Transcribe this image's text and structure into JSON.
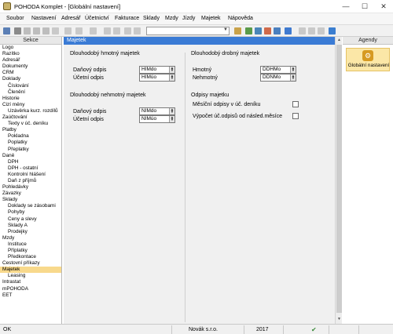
{
  "window": {
    "title": "POHODA Komplet - [Globální nastavení]",
    "minimize": "—",
    "maximize": "☐",
    "close": "✕"
  },
  "menu": [
    "Soubor",
    "Nastavení",
    "Adresář",
    "Účetnictví",
    "Fakturace",
    "Sklady",
    "Mzdy",
    "Jízdy",
    "Majetek",
    "Nápověda"
  ],
  "toolbar": {
    "combo_value": ""
  },
  "sidebar": {
    "header": "Sekce",
    "items": [
      {
        "label": "Logo"
      },
      {
        "label": "Razítko"
      },
      {
        "label": "Adresář"
      },
      {
        "label": "Dokumenty"
      },
      {
        "label": "CRM"
      },
      {
        "label": "Doklady"
      },
      {
        "label": "Číslování",
        "sub": true
      },
      {
        "label": "Členění",
        "sub": true
      },
      {
        "label": "Historie"
      },
      {
        "label": "Cizí měny"
      },
      {
        "label": "Uzávěrka kurz. rozdílů",
        "sub": true
      },
      {
        "label": "Zaúčtování"
      },
      {
        "label": "Texty v úč. deníku",
        "sub": true
      },
      {
        "label": "Platby"
      },
      {
        "label": "Pokladna",
        "sub": true
      },
      {
        "label": "Poplatky",
        "sub": true
      },
      {
        "label": "Přeplatky",
        "sub": true
      },
      {
        "label": "Daně"
      },
      {
        "label": "DPH",
        "sub": true
      },
      {
        "label": "DPH - ostatní",
        "sub": true
      },
      {
        "label": "Kontrolní hlášení",
        "sub": true
      },
      {
        "label": "Daň z příjmů",
        "sub": true
      },
      {
        "label": "Pohledávky"
      },
      {
        "label": "Závazky"
      },
      {
        "label": "Sklady"
      },
      {
        "label": "Doklady se zásobami",
        "sub": true
      },
      {
        "label": "Pohyby",
        "sub": true
      },
      {
        "label": "Ceny a slevy",
        "sub": true
      },
      {
        "label": "Sklady A",
        "sub": true
      },
      {
        "label": "Prodejky",
        "sub": true
      },
      {
        "label": "Mzdy"
      },
      {
        "label": "Instituce",
        "sub": true
      },
      {
        "label": "Příplatky",
        "sub": true
      },
      {
        "label": "Předkontace",
        "sub": true
      },
      {
        "label": "Cestovní příkazy"
      },
      {
        "label": "Majetek",
        "selected": true
      },
      {
        "label": "Leasing",
        "sub": true
      },
      {
        "label": "Intrastat"
      },
      {
        "label": "mPOHODA"
      },
      {
        "label": "EET"
      }
    ]
  },
  "main": {
    "header": "Majetek",
    "hmotny": {
      "title": "Dlouhodobý hmotný majetek",
      "danovy_label": "Daňový odpis",
      "danovy_value": "HIMdo",
      "ucetni_label": "Účetní odpis",
      "ucetni_value": "HIMúo"
    },
    "nehmotny": {
      "title": "Dlouhodobý nehmotný majetek",
      "danovy_label": "Daňový odpis",
      "danovy_value": "NIMdo",
      "ucetni_label": "Účetní odpis",
      "ucetni_value": "NIMúo"
    },
    "drobny": {
      "title": "Dlouhodobý drobný majetek",
      "hmotny_label": "Hmotný",
      "hmotny_value": "DDHMo",
      "nehmotny_label": "Nehmotný",
      "nehmotny_value": "DDNMo"
    },
    "odpisy": {
      "title": "Odpisy majetku",
      "check1_label": "Měsíční odpisy v úč. deníku",
      "check1_checked": false,
      "check2_label": "Výpočet úč.odpisů od násled.měsíce",
      "check2_checked": false
    }
  },
  "agendy": {
    "header": "Agendy",
    "item_label": "Globální nastavení"
  },
  "status": {
    "ok": "OK",
    "company": "Novák s.r.o.",
    "year": "2017"
  }
}
